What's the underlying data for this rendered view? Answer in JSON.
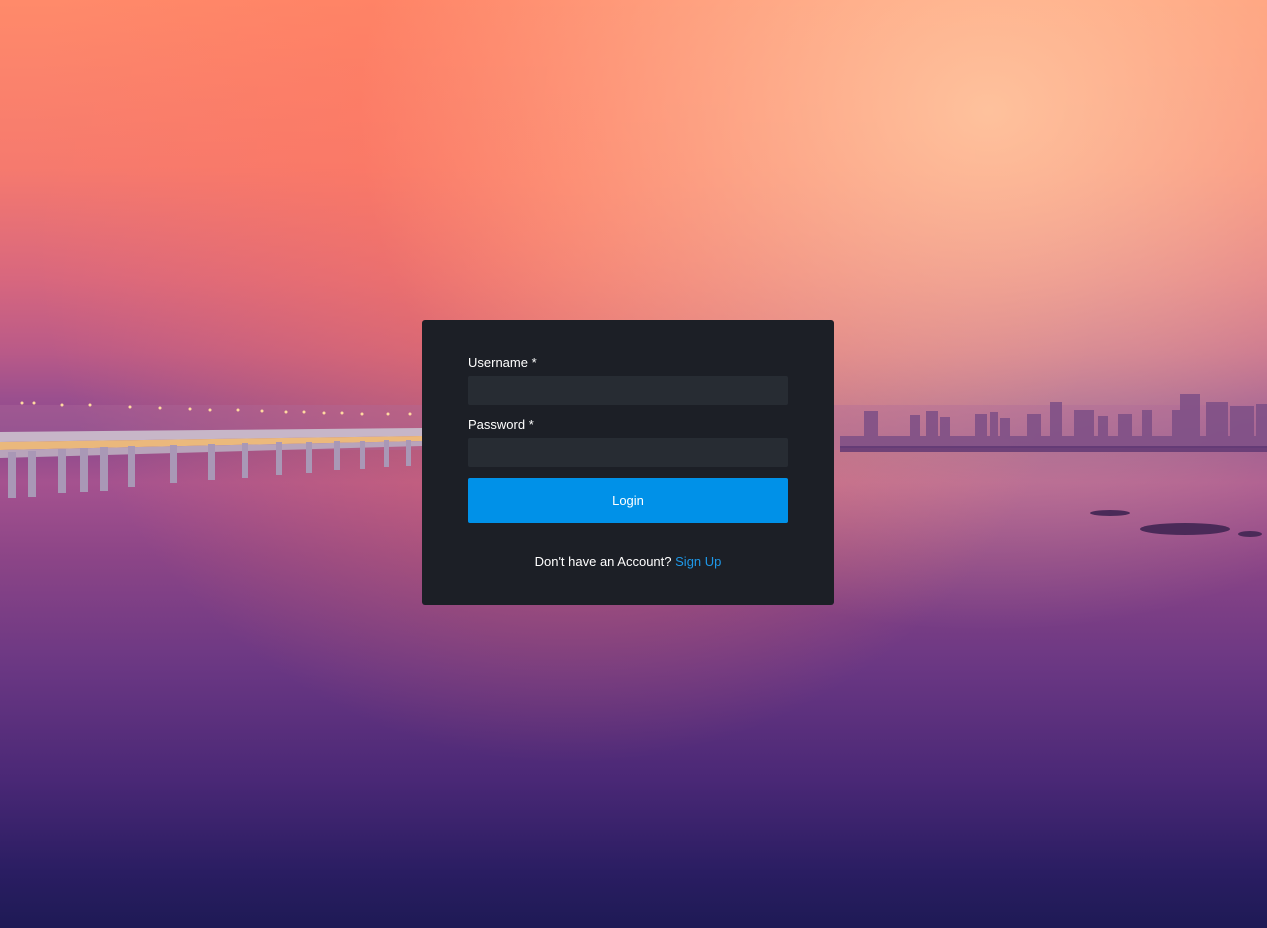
{
  "login_form": {
    "username_label": "Username *",
    "username_value": "",
    "password_label": "Password *",
    "password_value": "",
    "login_button": "Login",
    "signup_prompt": "Don't have an Account?",
    "signup_link": "Sign Up"
  },
  "colors": {
    "card_background": "#1c1f26",
    "input_background": "#272c33",
    "primary_button": "#0091e8",
    "link": "#1e98e8"
  }
}
